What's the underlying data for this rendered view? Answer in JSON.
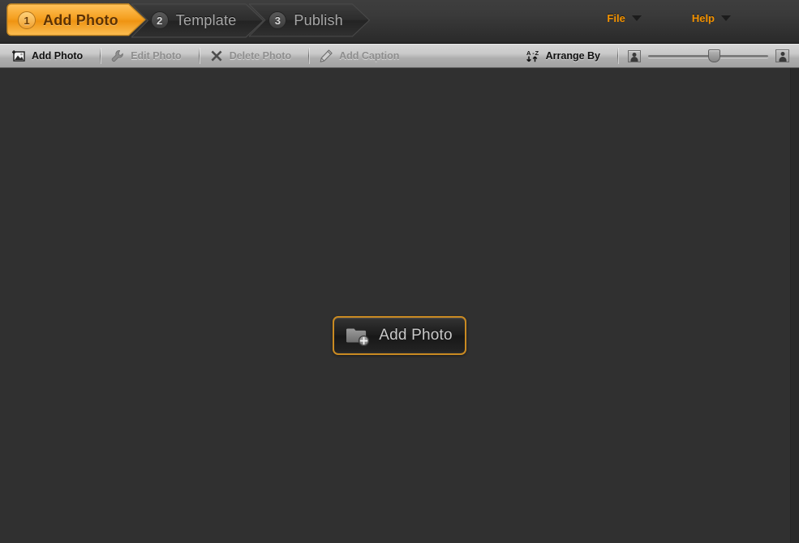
{
  "app": {
    "accent_color": "#f39200",
    "toolbar_bg": "#c9c9c9",
    "canvas_bg": "#303030"
  },
  "header": {
    "steps": [
      {
        "number": "1",
        "label": "Add Photo",
        "state": "active"
      },
      {
        "number": "2",
        "label": "Template",
        "state": "inactive"
      },
      {
        "number": "3",
        "label": "Publish",
        "state": "inactive"
      }
    ],
    "menus": [
      {
        "label": "File",
        "icon": "chevron-down-icon"
      },
      {
        "label": "Help",
        "icon": "chevron-down-icon"
      }
    ]
  },
  "toolbar": {
    "buttons": [
      {
        "label": "Add Photo",
        "icon": "add-photo-icon",
        "enabled": true
      },
      {
        "label": "Edit Photo",
        "icon": "wrench-icon",
        "enabled": false
      },
      {
        "label": "Delete Photo",
        "icon": "close-x-icon",
        "enabled": false
      },
      {
        "label": "Add Caption",
        "icon": "pencil-icon",
        "enabled": false
      }
    ],
    "arrange_by": {
      "label": "Arrange By",
      "icon": "sort-az-icon"
    },
    "zoom_slider": {
      "small_icon": "small-photo-icon",
      "large_icon": "large-photo-icon",
      "value": 55,
      "min": 0,
      "max": 100
    }
  },
  "canvas": {
    "add_photo_button": {
      "label": "Add Photo",
      "icon": "folder-add-icon"
    }
  }
}
